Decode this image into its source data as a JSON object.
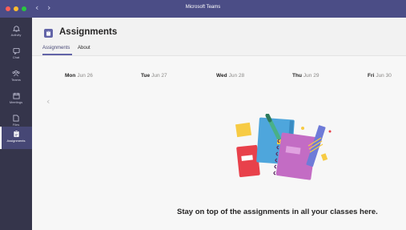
{
  "window": {
    "title": "Microsoft Teams",
    "traffic_light_colors": [
      "#ff5f57",
      "#febc2e",
      "#28c840"
    ]
  },
  "rail": {
    "items": [
      {
        "label": "Activity",
        "icon": "bell-icon"
      },
      {
        "label": "Chat",
        "icon": "chat-icon"
      },
      {
        "label": "Teams",
        "icon": "teams-icon"
      },
      {
        "label": "Meetings",
        "icon": "calendar-icon"
      },
      {
        "label": "Files",
        "icon": "file-icon"
      },
      {
        "label": "Assignments",
        "icon": "assignments-icon",
        "active": true
      }
    ]
  },
  "header": {
    "app_title": "Assignments",
    "tabs": [
      {
        "label": "Assignments",
        "active": true
      },
      {
        "label": "About",
        "active": false
      }
    ]
  },
  "calendar": {
    "days": [
      {
        "day": "Mon",
        "date": "Jun 26"
      },
      {
        "day": "Tue",
        "date": "Jun 27"
      },
      {
        "day": "Wed",
        "date": "Jun 28"
      },
      {
        "day": "Thu",
        "date": "Jun 29"
      },
      {
        "day": "Fri",
        "date": "Jun 30"
      }
    ]
  },
  "empty_state": {
    "message": "Stay on top of the assignments in all your classes here."
  },
  "colors": {
    "title_bar": "#4b4d86",
    "rail": "#35354b",
    "accent": "#6264a7"
  }
}
